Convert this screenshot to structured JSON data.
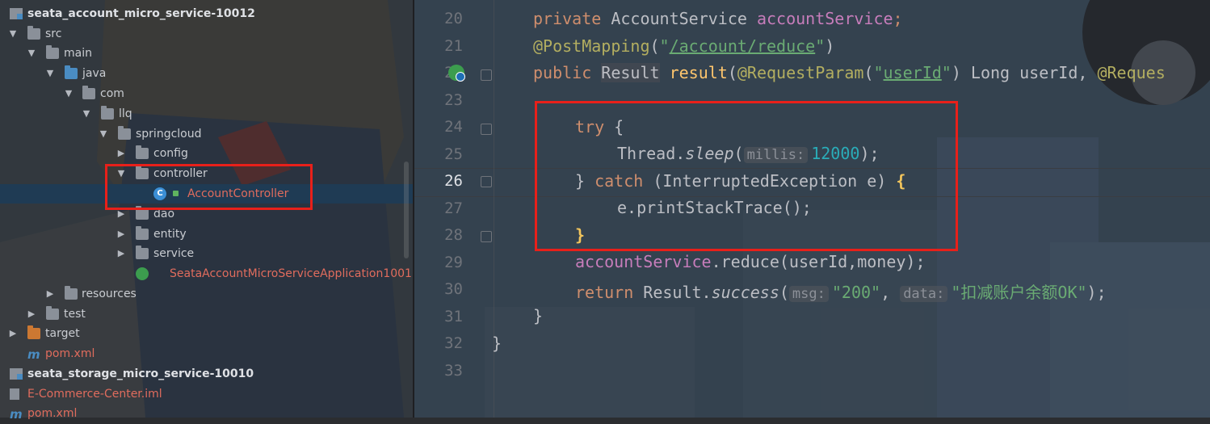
{
  "colors": {
    "accent_red": "#e8201a",
    "selection": "#1f3b54",
    "keyword": "#cf8e6d",
    "string": "#6aab73",
    "field": "#c77dbb",
    "annotation": "#b3ae60",
    "number": "#2aacb8"
  },
  "tree": {
    "root_module": "seata_account_micro_service-10012",
    "src": "src",
    "main": "main",
    "java": "java",
    "com": "com",
    "llq": "llq",
    "springcloud": "springcloud",
    "config": "config",
    "controller": "controller",
    "account_controller": "AccountController",
    "account_controller_icon": "C",
    "dao": "dao",
    "entity": "entity",
    "service": "service",
    "application_class": "SeataAccountMicroServiceApplication1001",
    "resources": "resources",
    "test": "test",
    "target": "target",
    "pom": "pom.xml",
    "storage_module": "seata_storage_micro_service-10010",
    "iml": "E-Commerce-Center.iml",
    "pom2": "pom.xml",
    "maven_icon": "m"
  },
  "editor": {
    "line_numbers": [
      "20",
      "21",
      "22",
      "23",
      "24",
      "25",
      "26",
      "27",
      "28",
      "29",
      "30",
      "31",
      "32",
      "33"
    ],
    "l20": {
      "kw": "private",
      "type": " AccountService ",
      "field": "accountService",
      "semi": ";"
    },
    "l21": {
      "ann": "@PostMapping",
      "p1": "(",
      "q1": "\"",
      "url": "/account/reduce",
      "q2": "\"",
      "p2": ")"
    },
    "l22": {
      "kw": "public",
      "sp": " ",
      "type": "Result",
      "sp2": " ",
      "meth": "result",
      "p1": "(",
      "ann": "@RequestParam",
      "p2": "(",
      "q1": "\"",
      "url": "userId",
      "q2": "\"",
      "rest": ") Long userId, ",
      "ann2": "@Reques"
    },
    "l24": {
      "kw": "try",
      "rest": " {"
    },
    "l25": {
      "pre": "Thread.",
      "meth": "sleep",
      "p1": "(",
      "hint": "millis:",
      "num": "12000",
      "p2": ");"
    },
    "l26": {
      "pre": "} ",
      "kw": "catch",
      "rest": " (InterruptedException e) ",
      "brace": "{"
    },
    "l27": {
      "text": "e.printStackTrace();"
    },
    "l28": {
      "brace": "}"
    },
    "l29": {
      "field": "accountService",
      "rest": ".reduce(userId,money);"
    },
    "l30": {
      "kw": "return",
      "pre": " Result.",
      "meth": "success",
      "p1": "(",
      "hint1": "msg:",
      "s1": "\"200\"",
      "comma": ", ",
      "hint2": "data:",
      "s2": "\"扣减账户余额OK\"",
      "p2": ");"
    },
    "l31": {
      "text": "}"
    },
    "l32": {
      "text": "}"
    }
  }
}
